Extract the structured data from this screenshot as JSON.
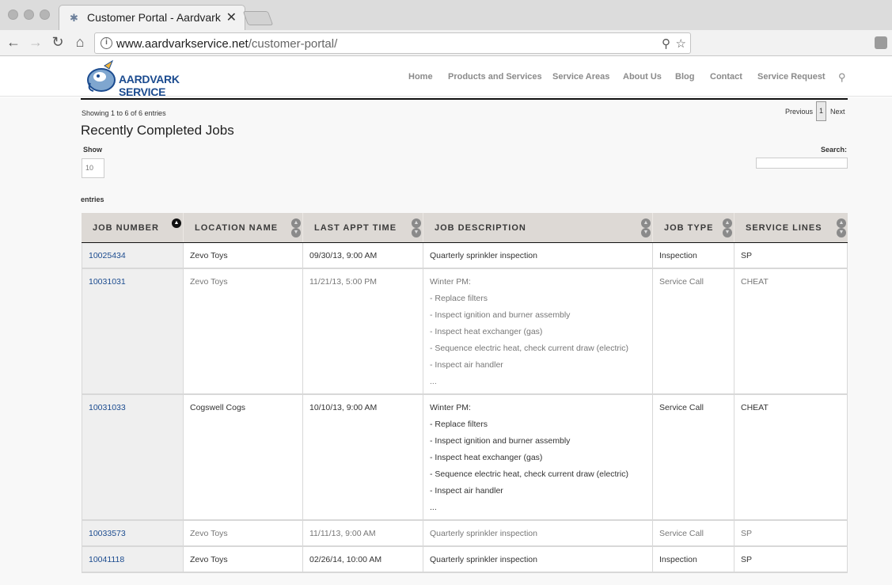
{
  "browser": {
    "tab_title": "Customer Portal - Aardvark Se",
    "url_host": "www.aardvarkservice.net",
    "url_path": "/customer-portal/"
  },
  "site": {
    "logo_text": "AARDVARK SERVICE",
    "nav": [
      "Home",
      "Products and Services",
      "Service Areas",
      "About Us",
      "Blog",
      "Contact",
      "Service Request"
    ]
  },
  "table_info": {
    "showing": "Showing 1 to 6 of 6 entries",
    "previous": "Previous",
    "current_page": "1",
    "next": "Next",
    "title": "Recently Completed Jobs",
    "show_label": "Show",
    "show_value": "10",
    "search_label": "Search:",
    "entries_label": "entries"
  },
  "columns": [
    "JOB NUMBER",
    "LOCATION NAME",
    "LAST APPT TIME",
    "JOB DESCRIPTION",
    "JOB TYPE",
    "SERVICE LINES"
  ],
  "rows": [
    {
      "job": "10025434",
      "location": "Zevo Toys",
      "time": "09/30/13, 9:00 AM",
      "desc": [
        "Quarterly sprinkler inspection"
      ],
      "type": "Inspection",
      "lines": "SP",
      "muted": false
    },
    {
      "job": "10031031",
      "location": "Zevo Toys",
      "time": "11/21/13, 5:00 PM",
      "desc": [
        "Winter PM:",
        "- Replace filters",
        "- Inspect ignition and burner assembly",
        "- Inspect heat exchanger (gas)",
        "- Sequence electric heat, check current draw (electric)",
        "- Inspect air handler",
        "..."
      ],
      "type": "Service Call",
      "lines": "CHEAT",
      "muted": true
    },
    {
      "job": "10031033",
      "location": "Cogswell Cogs",
      "time": "10/10/13, 9:00 AM",
      "desc": [
        "Winter PM:",
        "- Replace filters",
        "- Inspect ignition and burner assembly",
        "- Inspect heat exchanger (gas)",
        "- Sequence electric heat, check current draw (electric)",
        "- Inspect air handler",
        "..."
      ],
      "type": "Service Call",
      "lines": "CHEAT",
      "muted": false
    },
    {
      "job": "10033573",
      "location": "Zevo Toys",
      "time": "11/11/13, 9:00 AM",
      "desc": [
        "Quarterly sprinkler inspection"
      ],
      "type": "Service Call",
      "lines": "SP",
      "muted": true
    },
    {
      "job": "10041118",
      "location": "Zevo Toys",
      "time": "02/26/14, 10:00 AM",
      "desc": [
        "Quarterly sprinkler inspection"
      ],
      "type": "Inspection",
      "lines": "SP",
      "muted": false
    }
  ]
}
